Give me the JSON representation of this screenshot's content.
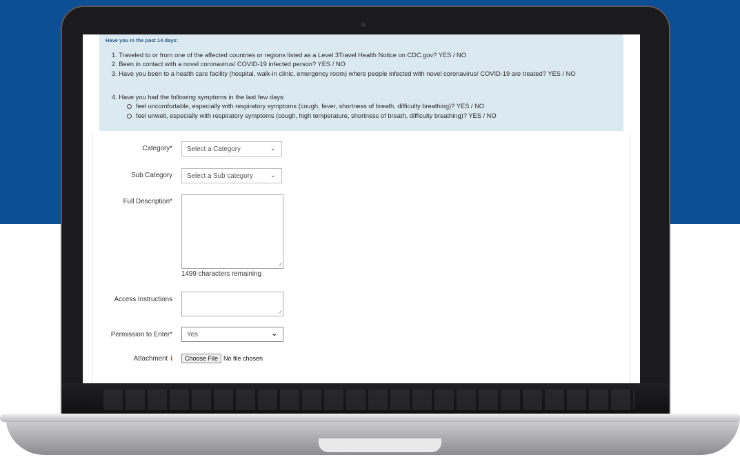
{
  "notice": {
    "title": "Have you in the past 14 days:",
    "q1": "1. Traveled to or from one of the affected countries or regions listed as a Level 3Travel Health Notice on CDC.gov?    YES / NO",
    "q2": "2. Been in contact with a novel coronavirus/ COVID-19 infected person?    YES / NO",
    "q3": "3. Have you been to a health care facility (hospital, walk-in clinic, emergency room) where people infected with novel coronavirus/ COVID-19 are treated?    YES / NO",
    "q4": "4. Have you had the following symptoms in the last few days:",
    "s1": "feel uncomfortable, especially with respiratory symptoms (cough, fever, shortness of breath, difficulty breathing)?      YES / NO",
    "s2": "feel unwell, especially with respiratory symptoms (cough, high temperature, shortness of breath, difficulty breathing)?    YES / NO"
  },
  "form": {
    "category_label": "Category*",
    "category_value": "Select a Category",
    "subcategory_label": "Sub Category",
    "subcategory_value": "Select a Sub category",
    "description_label": "Full Description*",
    "chars_remaining": "1499 characters remaining",
    "access_label": "Access Instructions",
    "permission_label": "Permission to Enter*",
    "permission_value": "Yes",
    "attachment_label": "Attachment",
    "file_button": "Choose File",
    "file_status": "No file chosen"
  },
  "icons": {
    "dropdown": "chevron-down-icon",
    "info": "info-icon",
    "resize": "resize-grip-icon"
  },
  "colors": {
    "background_blue": "#0d4f94",
    "notice_bg": "#dbe9f1",
    "info_red": "#c0392b"
  }
}
